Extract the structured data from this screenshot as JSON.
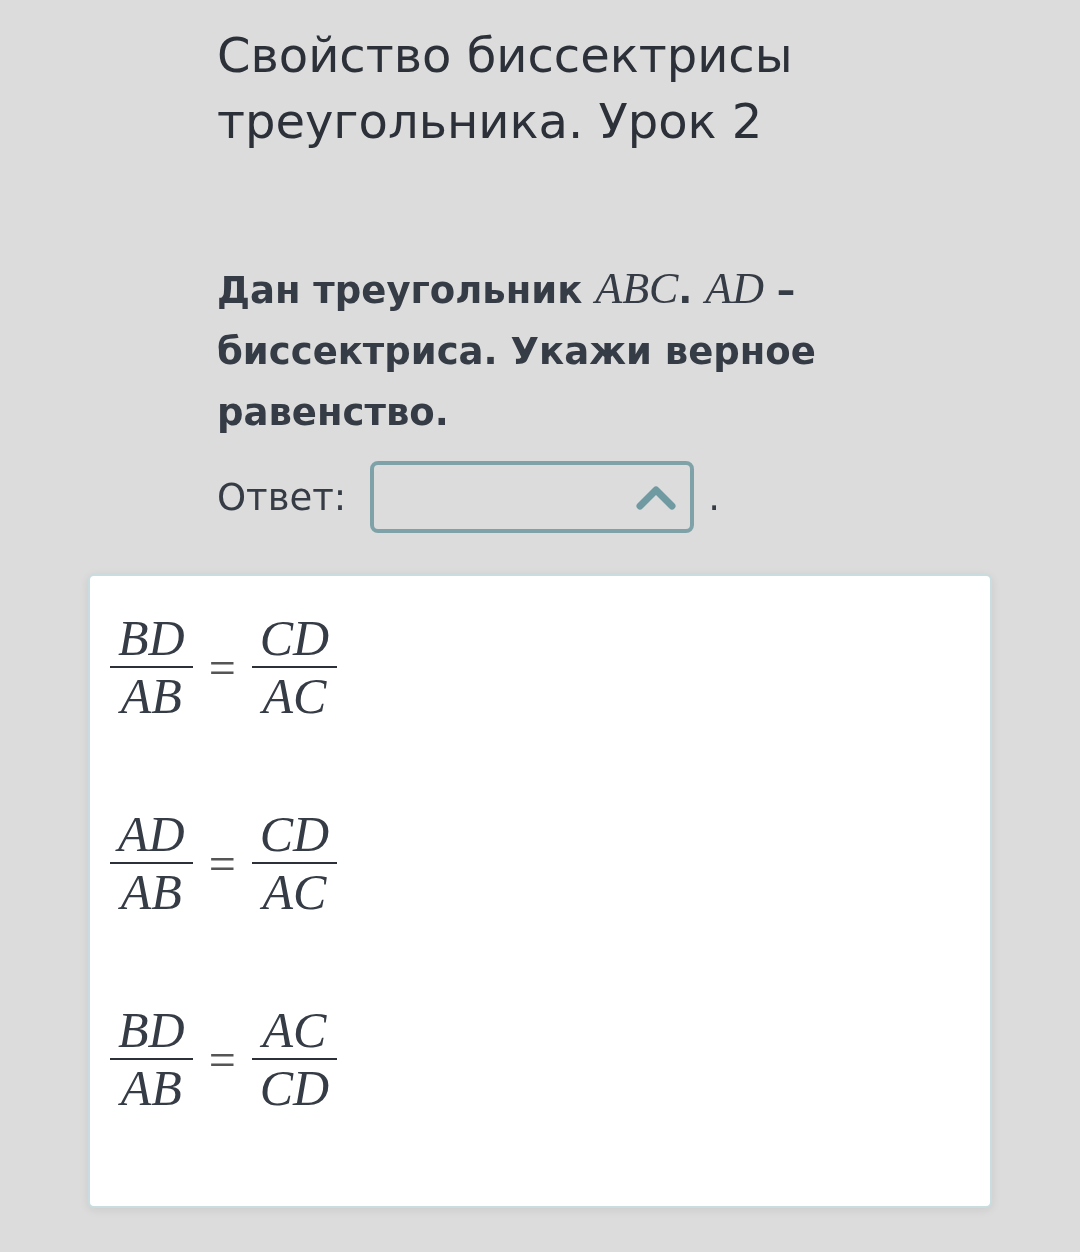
{
  "lesson": {
    "title": "Свойство биссектрисы треугольника. Урок 2"
  },
  "question": {
    "text": "Дан треугольник *ABC*. *AD* – биссектриса. Укажи верное равенство."
  },
  "answer": {
    "label": "Ответ:",
    "expanded": true,
    "after": "."
  },
  "options": [
    {
      "selected": false,
      "left": {
        "num": "BD",
        "den": "AB"
      },
      "equals": "=",
      "right": {
        "num": "CD",
        "den": "AC"
      }
    },
    {
      "selected": false,
      "left": {
        "num": "AD",
        "den": "AB"
      },
      "equals": "=",
      "right": {
        "num": "CD",
        "den": "AC"
      }
    },
    {
      "selected": false,
      "left": {
        "num": "BD",
        "den": "AB"
      },
      "equals": "=",
      "right": {
        "num": "AC",
        "den": "CD"
      }
    }
  ]
}
